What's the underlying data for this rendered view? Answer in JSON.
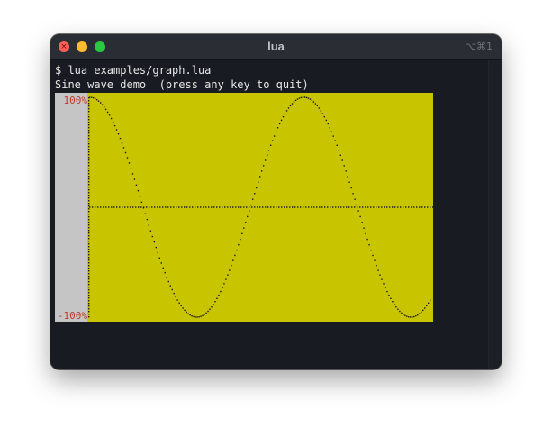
{
  "window": {
    "title": "lua",
    "shortcut": "⌥⌘1"
  },
  "terminal": {
    "prompt_line": "$ lua examples/graph.lua",
    "message_line": "Sine wave demo  (press any key to quit)"
  },
  "colors": {
    "plot_background": "#c9c400",
    "label_column": "#c5c5c5",
    "axis_label": "#c0392b",
    "dots": "#1a1a1a",
    "terminal_bg": "#181b22"
  },
  "chart_data": {
    "type": "line",
    "style": "dotted",
    "function": "sine",
    "y_tick_labels": [
      "100%",
      "-100%"
    ],
    "ylim": [
      -100,
      100
    ],
    "xlim": [
      0,
      1.59
    ],
    "x_unit": "cycles",
    "phase_cycles": 0.25,
    "zero_line": true,
    "grid": false,
    "legend": "none"
  }
}
